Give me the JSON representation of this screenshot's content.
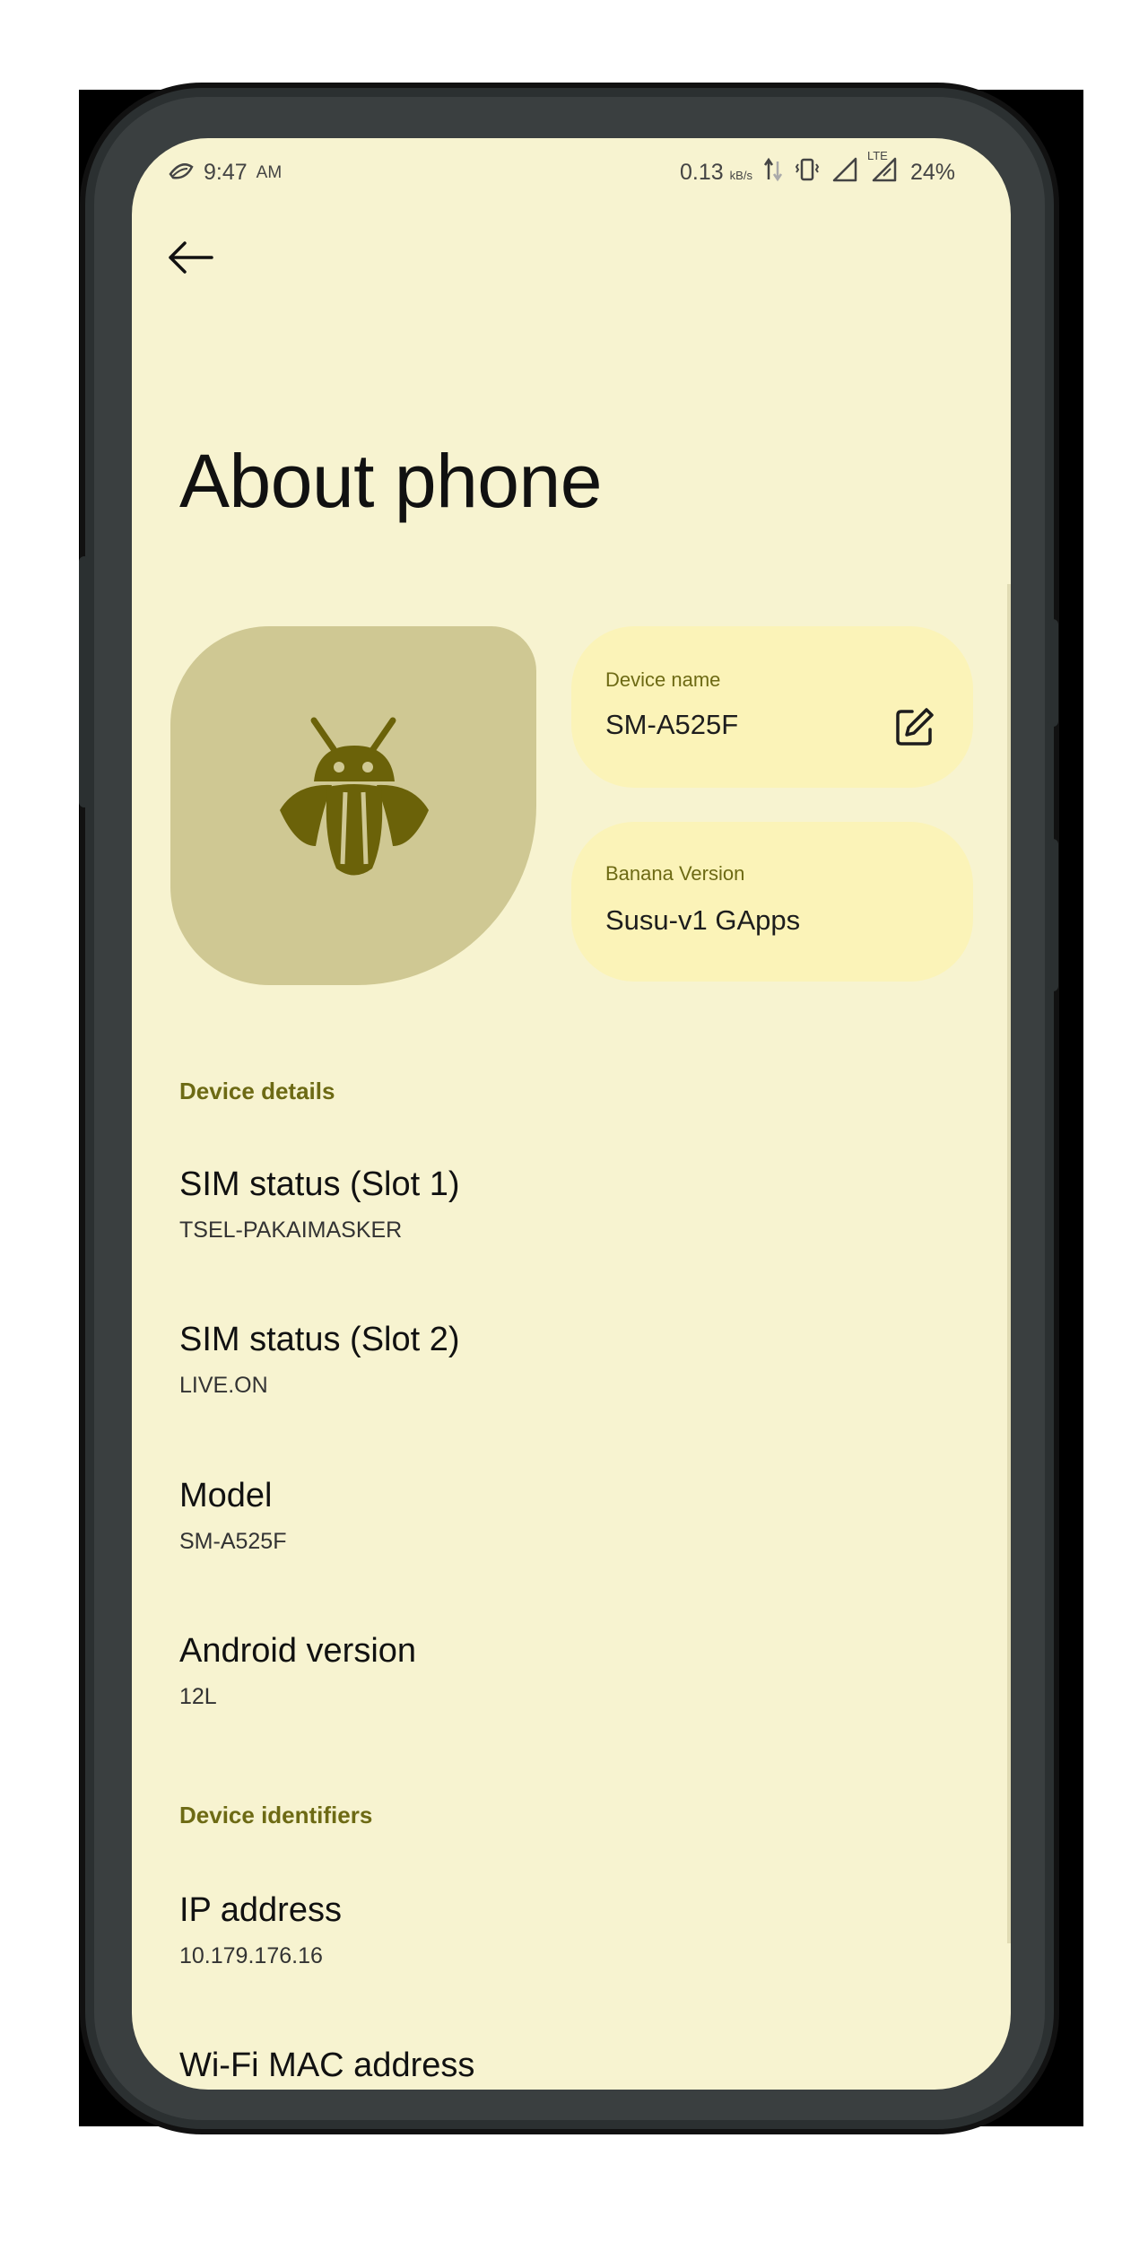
{
  "status_bar": {
    "time": "9:47",
    "ampm": "AM",
    "net_speed": "0.13",
    "net_unit": "kB/s",
    "lte_label": "LTE",
    "battery": "24%"
  },
  "header": {
    "back_icon": "arrow-back-icon",
    "title": "About phone"
  },
  "avatar": {
    "icon": "bug-android-icon",
    "color": "#6b6209"
  },
  "device_name_card": {
    "label": "Device name",
    "value": "SM-A525F",
    "edit_icon": "edit-icon"
  },
  "banana_card": {
    "label": "Banana Version",
    "value": "Susu-v1 GApps"
  },
  "sections": [
    {
      "header": "Device details",
      "items": [
        {
          "title": "SIM status (Slot 1)",
          "subtitle": "TSEL-PAKAIMASKER"
        },
        {
          "title": "SIM status (Slot 2)",
          "subtitle": "LIVE.ON"
        },
        {
          "title": "Model",
          "subtitle": "SM-A525F"
        },
        {
          "title": "Android version",
          "subtitle": "12L"
        }
      ]
    },
    {
      "header": "Device identifiers",
      "items": [
        {
          "title": "IP address",
          "subtitle": "10.179.176.16"
        },
        {
          "title": "Wi-Fi MAC address",
          "subtitle": ""
        }
      ]
    }
  ],
  "colors": {
    "screen_bg": "#f7f3d0",
    "card_bg": "#fbf3b8",
    "accent": "#6d6a14",
    "avatar_bg": "#cfc893"
  }
}
